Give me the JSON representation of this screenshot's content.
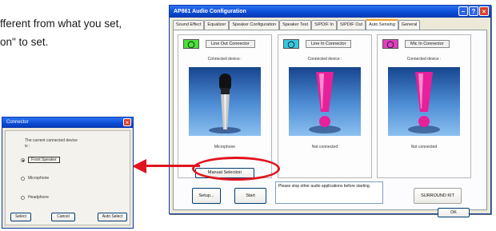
{
  "manual_text": {
    "line1": "fferent from what you set,",
    "line2": "on\" to set."
  },
  "main_window": {
    "title": "AP861 Audio Configuration",
    "tabs": [
      "Sound Effect",
      "Equalizer",
      "Speaker Configuration",
      "Speaker Test",
      "S/PDIF In",
      "S/PDIF Out",
      "Auto Sensing",
      "General"
    ],
    "active_tab": "Auto Sensing",
    "groups": [
      {
        "title": "Line Out Connector",
        "subtitle": "Connected device :",
        "device": "Microphone",
        "jack_color": "#4ce03a",
        "icon": "microphone-icon"
      },
      {
        "title": "Line In Connector",
        "subtitle": "Connected device :",
        "device": "Not connected",
        "jack_color": "#37c8e0",
        "icon": "exclamation-icon"
      },
      {
        "title": "Mic In Connector",
        "subtitle": "Connected device :",
        "device": "Not connected",
        "jack_color": "#e040c0",
        "icon": "exclamation-icon"
      }
    ],
    "manual_selection_label": "Manual Selection",
    "setup_label": "Setup...",
    "start_label": "Start",
    "status_text": "Please stop other audio applications before starting.",
    "surround_label": "SURROUND KIT",
    "ok_label": "OK"
  },
  "connector_dialog": {
    "title": "Connector",
    "question_line1": "The current connected device",
    "question_line2": "is :",
    "options": [
      "Front Speaker",
      "Microphone",
      "Headphone"
    ],
    "selected_option": "Front Speaker",
    "select_label": "Select",
    "cancel_label": "Cancel",
    "auto_select_label": "Auto Select"
  },
  "colors": {
    "annotation_red": "#e0141e",
    "titlebar_blue": "#0a4ad2"
  }
}
